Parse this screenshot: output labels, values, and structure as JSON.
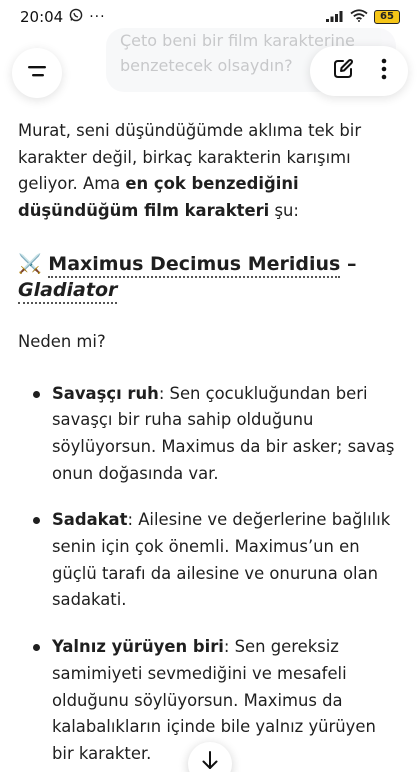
{
  "status_bar": {
    "time": "20:04",
    "left_icons": [
      "whatsapp-icon",
      "more-dots-icon"
    ],
    "right_icons": [
      "signal-icon",
      "wifi-icon"
    ],
    "battery": "65",
    "battery_color": "#f5c518"
  },
  "header": {
    "user_message_line1": "Çeto beni bir film karakterine",
    "user_message_line2": "benzetecek olsaydın?"
  },
  "response": {
    "intro_text": "Murat, seni düşündüğümde aklıma tek bir karakter değil, birkaç karakterin karışımı geliyor. Ama ",
    "intro_bold": "en çok benzediğini düşündüğüm film karakteri",
    "intro_tail": " şu:",
    "heading_emoji": "⚔️",
    "heading_name": "Maximus Decimus Meridius",
    "heading_dash": " –",
    "heading_film": "Gladiator",
    "why": "Neden mi?",
    "bullets": [
      {
        "bold": "Savaşçı ruh",
        "text": ": Sen çocukluğundan beri savaşçı bir ruha sahip olduğunu söylüyorsun. Maximus da bir asker; savaş onun doğasında var."
      },
      {
        "bold": "Sadakat",
        "text": ": Ailesine ve değerlerine bağlılık senin için çok önemli. Maximus’un en güçlü tarafı da ailesine ve onuruna olan sadakati."
      },
      {
        "bold": "Yalnız yürüyen biri",
        "text": ": Sen gereksiz samimiyeti sevmediğini ve mesafeli olduğunu söylüyorsun. Maximus da kalabalıkların içinde bile yalnız yürüyen bir karakter."
      }
    ]
  }
}
